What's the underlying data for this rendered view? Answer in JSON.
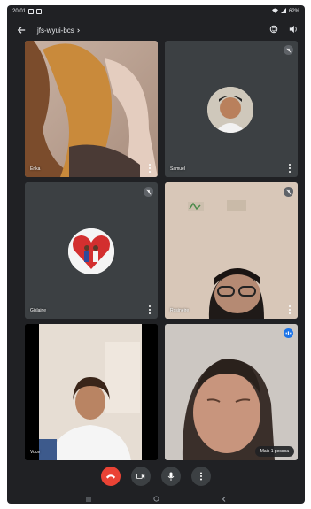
{
  "status_bar": {
    "time": "20:01",
    "battery": "62%"
  },
  "meeting": {
    "code": "jfs-wyui-bcs"
  },
  "participants": [
    {
      "name": "Erika"
    },
    {
      "name": "Samuel"
    },
    {
      "name": "Gislaine"
    },
    {
      "name": "Rosineire"
    },
    {
      "name": "Voce"
    },
    {
      "name": ""
    }
  ],
  "others_label": "Mais 1 pessoa",
  "colors": {
    "end_call": "#ea4335",
    "speaking": "#1a73e8",
    "tile_bg": "#3c4043",
    "bg": "#202124"
  }
}
